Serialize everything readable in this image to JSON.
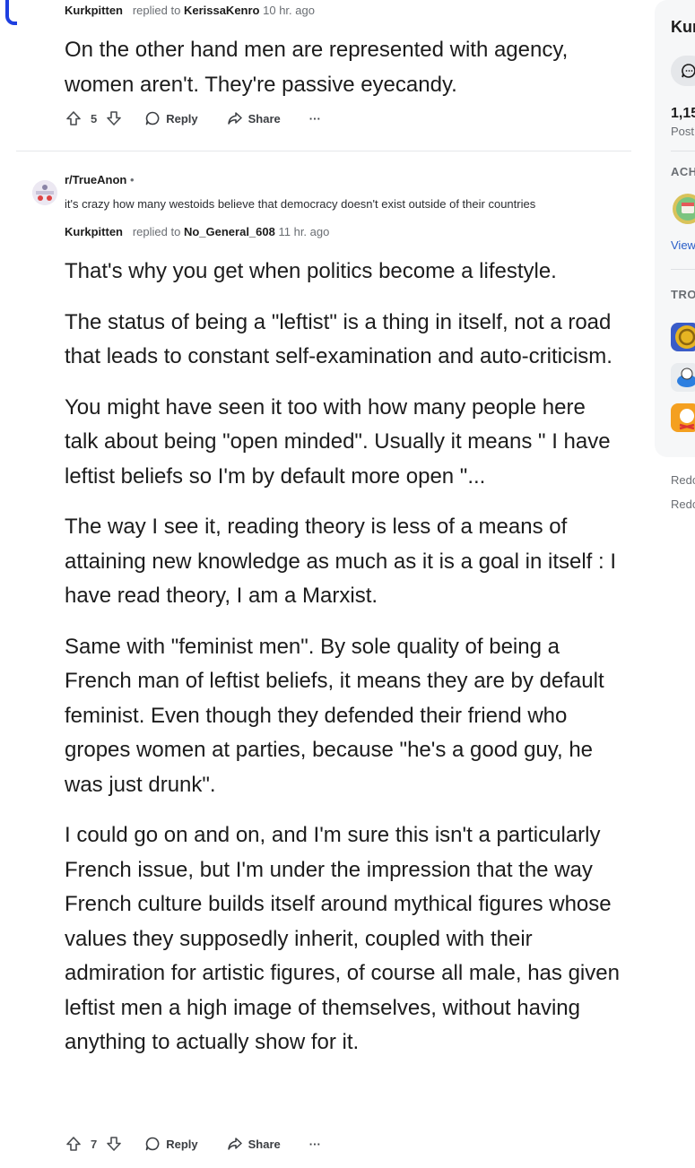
{
  "comment1": {
    "author": "Kurkpitten",
    "replied_to_text": "replied to",
    "replied_to": "KerissaKenro",
    "time": "10 hr. ago",
    "body": [
      "On the other hand men are represented with agency, women aren't. They're passive eyecandy."
    ],
    "score": "5",
    "reply_label": "Reply",
    "share_label": "Share",
    "more_label": "···"
  },
  "post": {
    "subreddit": "r/TrueAnon",
    "separator": "•",
    "title": "it's crazy how many westoids believe that democracy doesn't exist outside of their countries"
  },
  "comment2": {
    "author": "Kurkpitten",
    "replied_to_text": "replied to",
    "replied_to": "No_General_608",
    "time": "11 hr. ago",
    "body": [
      "That's why you get when politics become a lifestyle.",
      "The status of being a \"leftist\" is a thing in itself, not a road that leads to constant self-examination and auto-criticism.",
      "You might have seen it too with how many people here talk about being \"open minded\". Usually it means \" I have leftist beliefs so I'm by default more open \"...",
      "The way I see it, reading theory is less of a means of attaining new knowledge as much as it is a goal in itself : I have read theory, I am a Marxist.",
      "Same with \"feminist men\". By sole quality of being a French man of leftist beliefs, it means they are by default feminist. Even though they defended their friend who gropes women at parties, because \"he's a good guy, he was just drunk\".",
      "I could go on and on, and I'm sure this isn't a particularly French issue, but I'm under the impression that the way French culture builds itself around mythical figures whose values they supposedly inherit, coupled with their admiration for artistic figures, of course all male, has given leftist men a high image of themselves, without having anything to actually show for it."
    ],
    "score": "7",
    "reply_label": "Reply",
    "share_label": "Share",
    "more_label": "···"
  },
  "sidebar": {
    "name": "Kur",
    "count": "1,15",
    "count_label": "Post",
    "achievements_head": "ACH",
    "view_label": "View",
    "trophies_head": "TRO",
    "footer": [
      "Redo",
      "Redo"
    ]
  },
  "colors": {
    "accent_blue": "#1e3fe0",
    "link": "#2a5ec8",
    "muted": "#6a6e73"
  }
}
